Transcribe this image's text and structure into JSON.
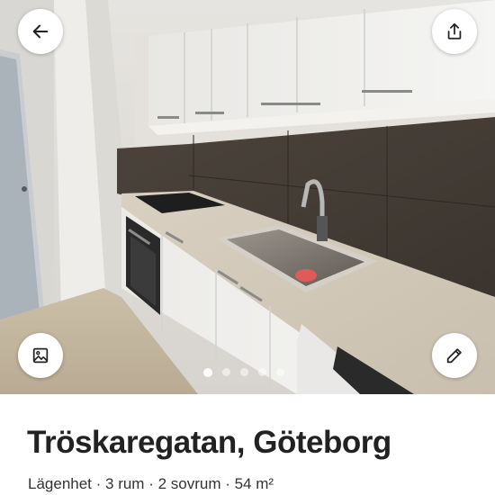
{
  "listing": {
    "title": "Tröskaregatan, Göteborg",
    "subtitle": "Lägenhet · 3 rum · 2 sovrum · 54 m²"
  },
  "carousel": {
    "total_images": 5,
    "active_index": 0
  },
  "buttons": {
    "back_icon": "arrow-left-icon",
    "share_icon": "share-icon",
    "gallery_icon": "image-icon",
    "edit_icon": "pencil-icon"
  },
  "colors": {
    "button_bg": "#ffffff",
    "title_text": "#222222",
    "dot_inactive": "rgba(255,255,255,0.55)",
    "dot_active": "#ffffff"
  }
}
